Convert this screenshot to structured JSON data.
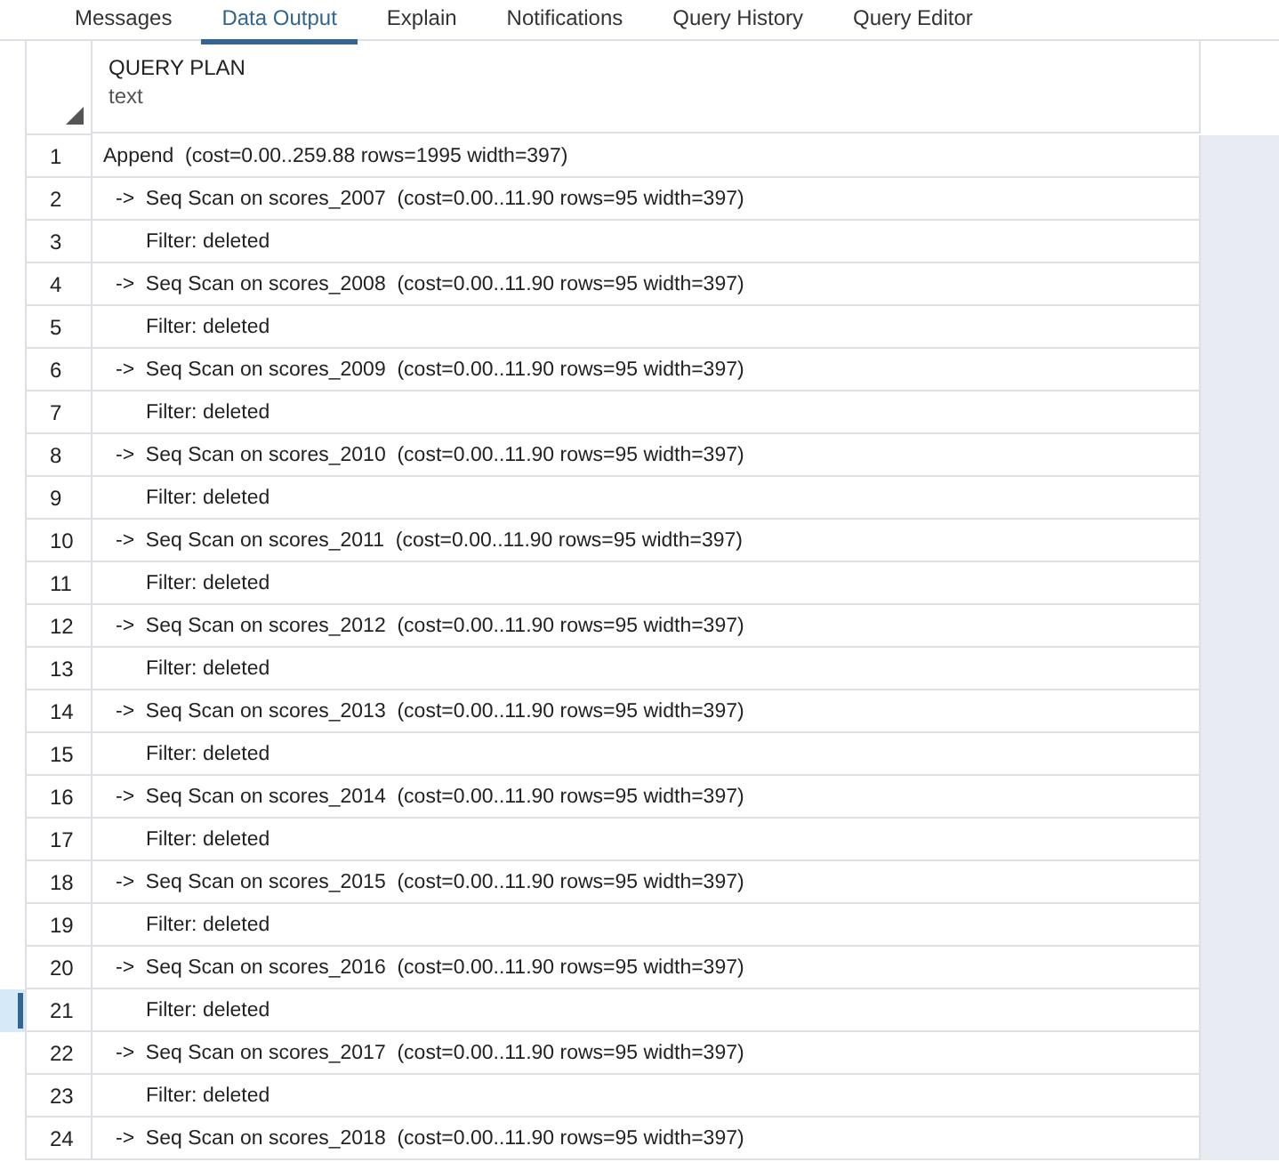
{
  "tabs": [
    {
      "label": "Messages",
      "selected": false
    },
    {
      "label": "Data Output",
      "selected": true
    },
    {
      "label": "Explain",
      "selected": false
    },
    {
      "label": "Notifications",
      "selected": false
    },
    {
      "label": "Query History",
      "selected": false
    },
    {
      "label": "Query Editor",
      "selected": false
    }
  ],
  "table": {
    "column": {
      "name": "QUERY PLAN",
      "type": "text"
    },
    "rows": [
      {
        "number": "1",
        "kind": "root",
        "text": "Append  (cost=0.00..259.88 rows=1995 width=397)",
        "selected": false
      },
      {
        "number": "2",
        "kind": "scan",
        "text": "->  Seq Scan on scores_2007  (cost=0.00..11.90 rows=95 width=397)",
        "selected": false
      },
      {
        "number": "3",
        "kind": "filter",
        "text": "Filter: deleted",
        "selected": false
      },
      {
        "number": "4",
        "kind": "scan",
        "text": "->  Seq Scan on scores_2008  (cost=0.00..11.90 rows=95 width=397)",
        "selected": false
      },
      {
        "number": "5",
        "kind": "filter",
        "text": "Filter: deleted",
        "selected": false
      },
      {
        "number": "6",
        "kind": "scan",
        "text": "->  Seq Scan on scores_2009  (cost=0.00..11.90 rows=95 width=397)",
        "selected": false
      },
      {
        "number": "7",
        "kind": "filter",
        "text": "Filter: deleted",
        "selected": false
      },
      {
        "number": "8",
        "kind": "scan",
        "text": "->  Seq Scan on scores_2010  (cost=0.00..11.90 rows=95 width=397)",
        "selected": false
      },
      {
        "number": "9",
        "kind": "filter",
        "text": "Filter: deleted",
        "selected": false
      },
      {
        "number": "10",
        "kind": "scan",
        "text": "->  Seq Scan on scores_2011  (cost=0.00..11.90 rows=95 width=397)",
        "selected": false
      },
      {
        "number": "11",
        "kind": "filter",
        "text": "Filter: deleted",
        "selected": false
      },
      {
        "number": "12",
        "kind": "scan",
        "text": "->  Seq Scan on scores_2012  (cost=0.00..11.90 rows=95 width=397)",
        "selected": false
      },
      {
        "number": "13",
        "kind": "filter",
        "text": "Filter: deleted",
        "selected": false
      },
      {
        "number": "14",
        "kind": "scan",
        "text": "->  Seq Scan on scores_2013  (cost=0.00..11.90 rows=95 width=397)",
        "selected": false
      },
      {
        "number": "15",
        "kind": "filter",
        "text": "Filter: deleted",
        "selected": false
      },
      {
        "number": "16",
        "kind": "scan",
        "text": "->  Seq Scan on scores_2014  (cost=0.00..11.90 rows=95 width=397)",
        "selected": false
      },
      {
        "number": "17",
        "kind": "filter",
        "text": "Filter: deleted",
        "selected": false
      },
      {
        "number": "18",
        "kind": "scan",
        "text": "->  Seq Scan on scores_2015  (cost=0.00..11.90 rows=95 width=397)",
        "selected": false
      },
      {
        "number": "19",
        "kind": "filter",
        "text": "Filter: deleted",
        "selected": false
      },
      {
        "number": "20",
        "kind": "scan",
        "text": "->  Seq Scan on scores_2016  (cost=0.00..11.90 rows=95 width=397)",
        "selected": false
      },
      {
        "number": "21",
        "kind": "filter",
        "text": "Filter: deleted",
        "selected": true
      },
      {
        "number": "22",
        "kind": "scan",
        "text": "->  Seq Scan on scores_2017  (cost=0.00..11.90 rows=95 width=397)",
        "selected": false
      },
      {
        "number": "23",
        "kind": "filter",
        "text": "Filter: deleted",
        "selected": false
      },
      {
        "number": "24",
        "kind": "scan",
        "text": "->  Seq Scan on scores_2018  (cost=0.00..11.90 rows=95 width=397)",
        "selected": false
      }
    ]
  }
}
